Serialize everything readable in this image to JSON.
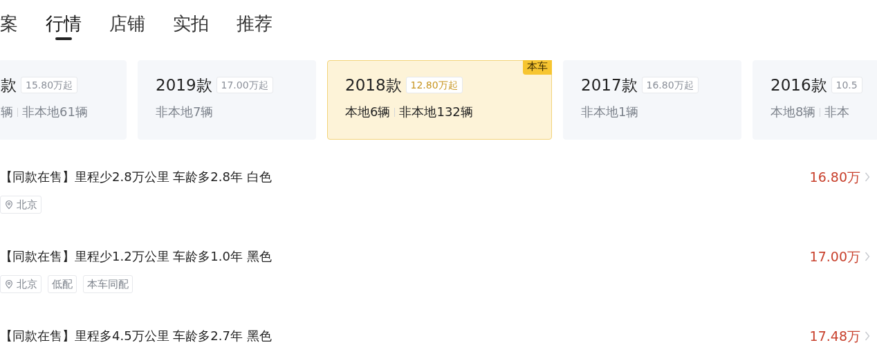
{
  "tabs": [
    {
      "label": "案",
      "selected": false
    },
    {
      "label": "行情",
      "selected": true
    },
    {
      "label": "店铺",
      "selected": false
    },
    {
      "label": "实拍",
      "selected": false
    },
    {
      "label": "推荐",
      "selected": false
    }
  ],
  "year_cards": [
    {
      "year": "款",
      "price": "15.80万起",
      "local": "辆",
      "nonlocal": "非本地61辆",
      "selected": false
    },
    {
      "year": "2019款",
      "price": "17.00万起",
      "nonlocal": "非本地7辆",
      "selected": false
    },
    {
      "year": "2018款",
      "price": "12.80万起",
      "local": "本地6辆",
      "nonlocal": "非本地132辆",
      "selected": true,
      "badge": "本车"
    },
    {
      "year": "2017款",
      "price": "16.80万起",
      "nonlocal": "非本地1辆",
      "selected": false
    },
    {
      "year": "2016款",
      "price": "10.5",
      "local": "本地8辆",
      "nonlocal": "非本",
      "selected": false
    }
  ],
  "listings": [
    {
      "title": "【同款在售】里程少2.8万公里 车龄多2.8年 白色",
      "price": "16.80万",
      "tags": [
        {
          "kind": "location",
          "label": "北京"
        }
      ]
    },
    {
      "title": "【同款在售】里程少1.2万公里 车龄多1.0年 黑色",
      "price": "17.00万",
      "tags": [
        {
          "kind": "location",
          "label": "北京"
        },
        {
          "kind": "plain",
          "label": "低配"
        },
        {
          "kind": "plain",
          "label": "本车同配"
        }
      ]
    },
    {
      "title": "【同款在售】里程多4.5万公里 车龄多2.7年 黑色",
      "price": "17.48万"
    }
  ]
}
